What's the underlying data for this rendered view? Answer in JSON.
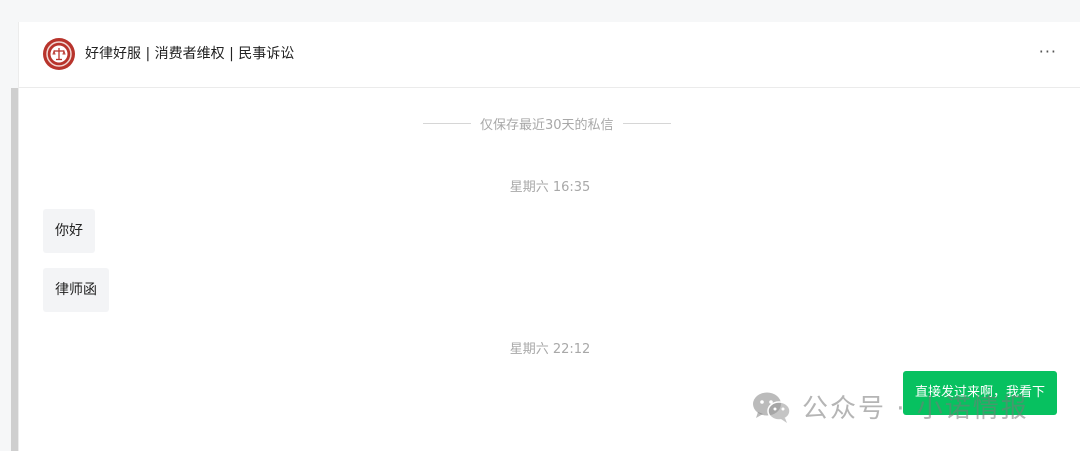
{
  "header": {
    "contact_name": "好律好服 | 消费者维权 | 民事诉讼",
    "more_label": "···"
  },
  "notice": {
    "text": "仅保存最近30天的私信"
  },
  "messages": [
    {
      "type": "time",
      "text": "星期六 16:35"
    },
    {
      "type": "incoming",
      "text": "你好"
    },
    {
      "type": "incoming",
      "text": "律师函"
    },
    {
      "type": "time",
      "text": "星期六 22:12"
    },
    {
      "type": "outgoing",
      "text": "直接发过来啊，我看下"
    }
  ],
  "watermark": {
    "text": "公众号 · 小诺情报"
  },
  "colors": {
    "outgoing_bubble": "#07c160",
    "incoming_bubble": "#f3f4f6",
    "avatar": "#b8342c"
  },
  "icons": {
    "avatar": "scales-of-justice-icon",
    "watermark": "wechat-icon"
  }
}
